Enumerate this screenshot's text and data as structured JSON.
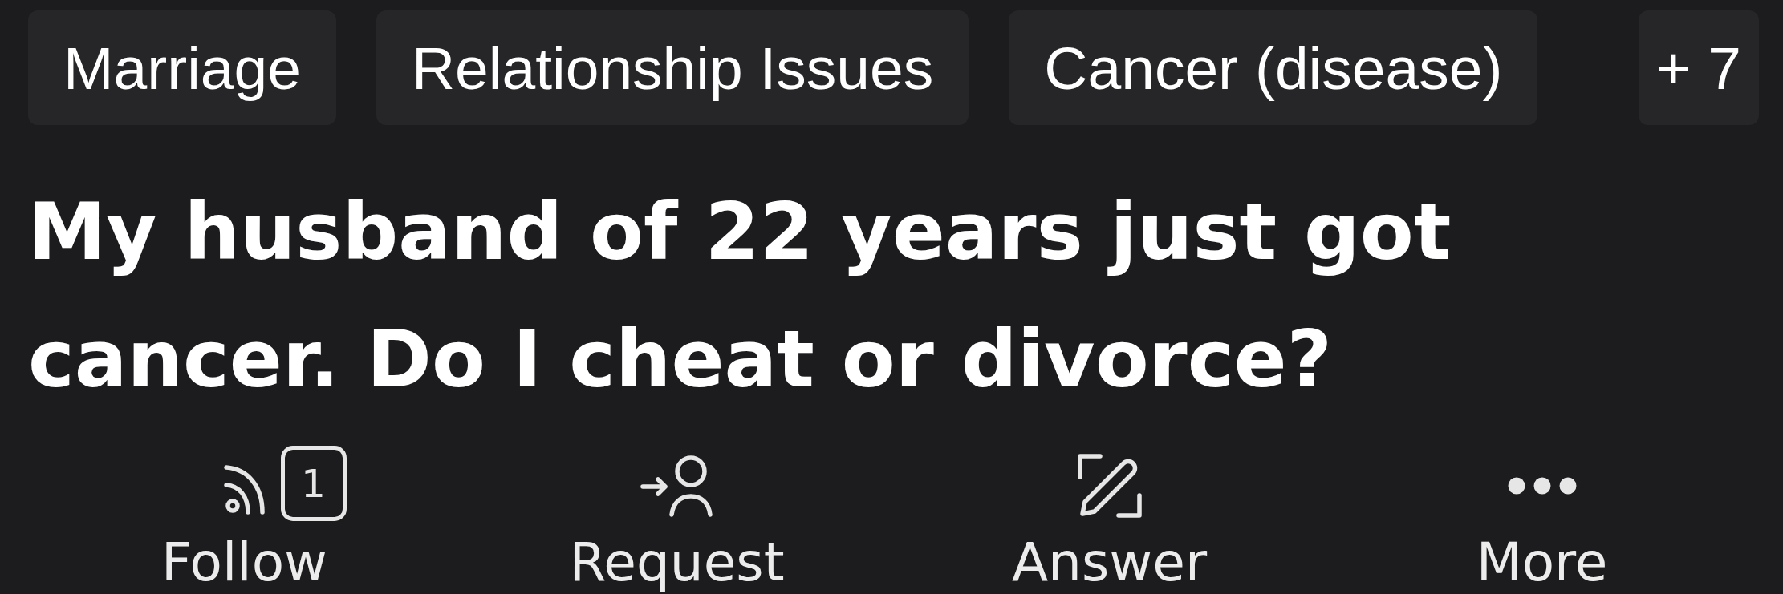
{
  "tags": [
    "Marriage",
    "Relationship Issues",
    "Cancer (disease)"
  ],
  "more_tags": "+ 7",
  "question": {
    "title": "My husband of 22 years just got cancer. Do I cheat or divorce?"
  },
  "actions": [
    {
      "kind": "follow",
      "label": "Follow",
      "badge": "1"
    },
    {
      "kind": "request",
      "label": "Request"
    },
    {
      "kind": "answer",
      "label": "Answer"
    },
    {
      "kind": "more",
      "label": "More"
    }
  ]
}
